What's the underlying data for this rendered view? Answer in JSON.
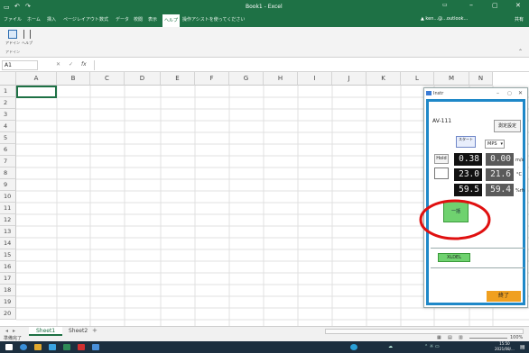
{
  "window": {
    "title": "Book1 - Excel",
    "account": "▲ ken...@...outlook...",
    "share_label": "共有"
  },
  "ribbon": {
    "tabs": [
      "ファイル",
      "ホーム",
      "挿入",
      "ページレイアウト",
      "数式",
      "データ",
      "校閲",
      "表示",
      "ヘルプ",
      "操作アシストを使ってください"
    ],
    "active_tab_index": 8,
    "group_buttons": [
      {
        "label": "アドイン",
        "icon": "addin-icon"
      },
      {
        "label": "ヘルプ",
        "icon": "help-icon"
      }
    ],
    "group_name": "アドイン"
  },
  "formula_bar": {
    "name_box": "A1",
    "fx": "fx",
    "value": ""
  },
  "grid": {
    "columns": [
      "A",
      "B",
      "C",
      "D",
      "E",
      "F",
      "G",
      "H",
      "I",
      "J",
      "K",
      "L",
      "M",
      "N"
    ],
    "rows": [
      "1",
      "2",
      "3",
      "4",
      "5",
      "6",
      "7",
      "8",
      "9",
      "10",
      "11",
      "12",
      "13",
      "14",
      "15",
      "16",
      "17",
      "18",
      "19",
      "20"
    ]
  },
  "sheets": {
    "tabs": [
      "Sheet1",
      "Sheet2"
    ],
    "active": 0,
    "add_label": "+"
  },
  "status": {
    "left": "準備完了",
    "zoom": "100%"
  },
  "dialog": {
    "title": "Instr",
    "device": "AV-111",
    "header_button": "測定設定",
    "mode_button": "スタート",
    "dropdown_value": "MPS",
    "hold_label": "Hold",
    "readings": [
      {
        "current": "0.38",
        "stored": "0.00",
        "unit": "m/s"
      },
      {
        "current": "23.0",
        "stored": "21.6",
        "unit": "°C"
      },
      {
        "current": "59.5",
        "stored": "59.4",
        "unit": "%rh"
      }
    ],
    "action_button": "一括",
    "bottom_button": "XLDEL",
    "end_button": "終了"
  },
  "taskbar": {
    "time": "15:50",
    "date": "2021/08/..."
  },
  "colors": {
    "excel_green": "#1e7145",
    "dialog_border": "#1e88c8",
    "green_button": "#6fd26f",
    "highlight_red": "#e01010",
    "end_button": "#f0a020"
  }
}
